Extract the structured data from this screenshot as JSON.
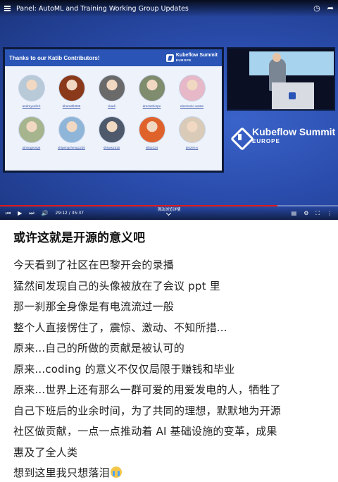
{
  "player": {
    "title": "Panel: AutoML and Training Working Group Updates",
    "current_time": "29:12",
    "duration": "35:37",
    "time_display": "29:12 / 35:37",
    "progress": 0.82,
    "caption_hint": "滑动浏览详情",
    "accent_color": "#e01b1b"
  },
  "slide": {
    "title": "Thanks to our Katib Contributors!",
    "logo_line1": "Kubeflow Summit",
    "logo_line2": "EUROPE",
    "contributors": [
      {
        "name": "andreyvelich",
        "color": "#b8c9d8"
      },
      {
        "name": "bharathk005",
        "color": "#8a3a1a"
      },
      {
        "name": "ckadi",
        "color": "#6a6a6a"
      },
      {
        "name": "droctothorpe",
        "color": "#7f8c6d"
      },
      {
        "name": "electronic-waste",
        "color": "#e6b8c8"
      },
      {
        "name": "johnugeorge",
        "color": "#a7b58e"
      },
      {
        "name": "shipengcheng1230",
        "color": "#8fb6d9"
      },
      {
        "name": "shivas1516",
        "color": "#4e5a6b"
      },
      {
        "name": "sifa1024",
        "color": "#e0622b"
      },
      {
        "name": "tenzen-y",
        "color": "#d9cbb8"
      }
    ]
  },
  "summit": {
    "line1": "Kubeflow Summit",
    "line2": "EUROPE"
  },
  "post": {
    "title": "或许这就是开源的意义吧",
    "lines": [
      "今天看到了社区在巴黎开会的录播",
      "猛然间发现自己的头像被放在了会议 ppt 里",
      "那一刹那全身像是有电流流过一般",
      "整个人直接愣住了，震惊、激动、不知所措...",
      "原来...自己的所做的贡献是被认可的",
      "原来...coding 的意义不仅仅局限于赚钱和毕业",
      "原来...世界上还有那么一群可爱的用爱发电的人，牺牲了",
      "自己下班后的业余时间，为了共同的理想，默默地为开源",
      "社区做贡献，一点一点推动着 AI 基础设施的变革，成果",
      "惠及了全人类",
      "想到这里我只想落泪"
    ],
    "trailing_emoji": "crying-face-icon"
  }
}
